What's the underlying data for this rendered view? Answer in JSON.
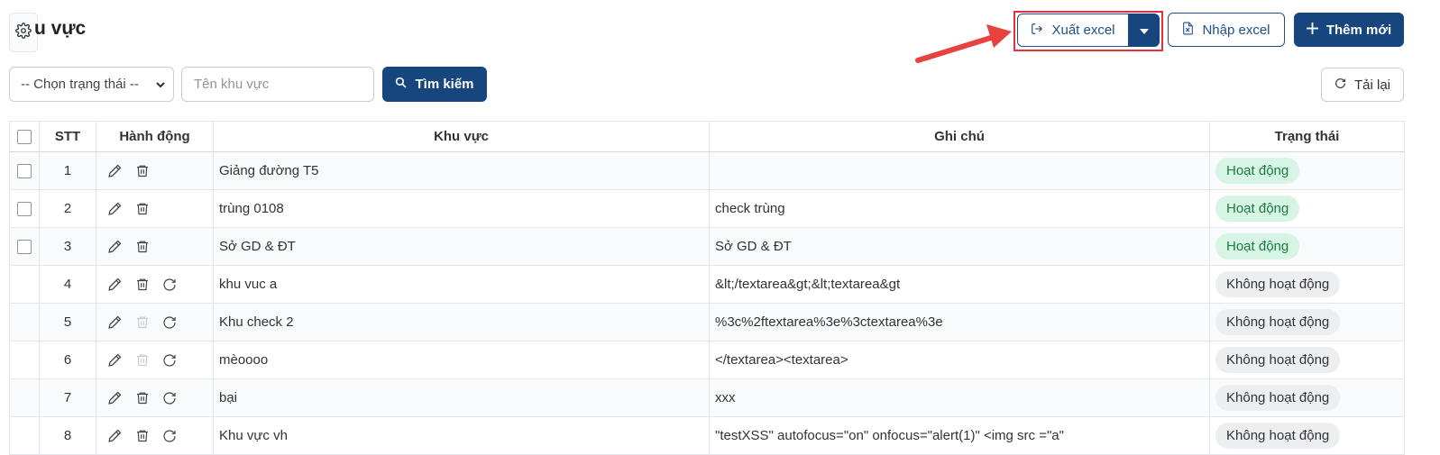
{
  "header": {
    "title": "u vực",
    "export_label": "Xuất excel",
    "import_label": "Nhập excel",
    "add_label": "Thêm mới"
  },
  "filters": {
    "status_value": "-- Chọn trạng thái --",
    "name_placeholder": "Tên khu vực",
    "search_label": "Tìm kiếm",
    "reload_label": "Tải lại"
  },
  "table": {
    "columns": [
      "STT",
      "Hành động",
      "Khu vực",
      "Ghi chú",
      "Trạng thái"
    ],
    "rows": [
      {
        "stt": "1",
        "area": "Giảng đường T5",
        "note": "",
        "status": "Hoạt động",
        "active": true
      },
      {
        "stt": "2",
        "area": "trùng 0108",
        "note": "check trùng",
        "status": "Hoạt động",
        "active": true
      },
      {
        "stt": "3",
        "area": "Sở GD & ĐT",
        "note": "Sở GD & ĐT",
        "status": "Hoạt động",
        "active": true
      },
      {
        "stt": "4",
        "area": "khu vuc a",
        "note": "&lt;/textarea&gt;&lt;textarea&gt",
        "status": "Không hoạt động",
        "active": false
      },
      {
        "stt": "5",
        "area": "Khu check 2",
        "note": "%3c%2ftextarea%3e%3ctextarea%3e",
        "status": "Không hoạt động",
        "active": false
      },
      {
        "stt": "6",
        "area": "mèoooo",
        "note": "</textarea><textarea>",
        "status": "Không hoạt động",
        "active": false
      },
      {
        "stt": "7",
        "area": "bại",
        "note": "xxx",
        "status": "Không hoạt động",
        "active": false
      },
      {
        "stt": "8",
        "area": "Khu vực vh",
        "note": "\"testXSS\" autofocus=\"on\" onfocus=\"alert(1)\" <img src =\"a\"",
        "status": "Không hoạt động",
        "active": false
      }
    ]
  },
  "colors": {
    "primary": "#17467f",
    "highlight": "#e0323a",
    "arrow": "#e8423e",
    "active_bg": "#d7f5e4",
    "inactive_bg": "#eceef0"
  },
  "icons": [
    "gear-icon",
    "export-icon",
    "caret-down-icon",
    "file-excel-icon",
    "plus-icon",
    "search-icon",
    "refresh-icon",
    "edit-icon",
    "trash-icon",
    "restore-icon",
    "chevron-down-icon"
  ]
}
